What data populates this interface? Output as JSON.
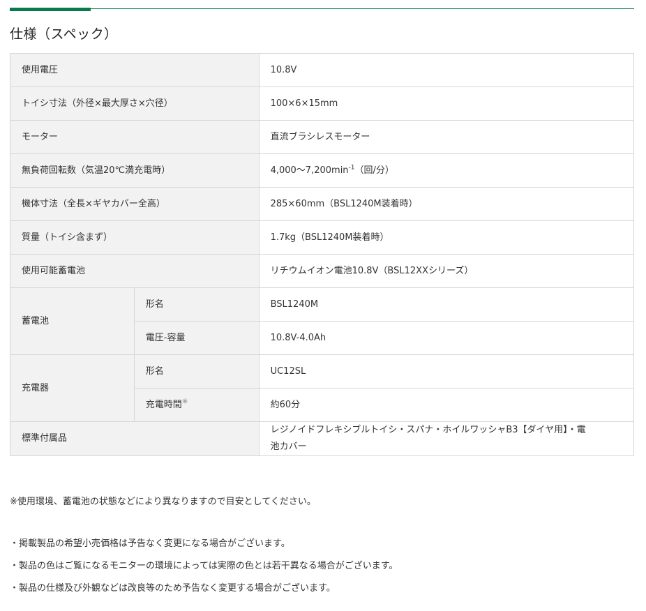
{
  "section_title": "仕様（スペック）",
  "rows": {
    "voltage": {
      "label": "使用電圧",
      "value": "10.8V"
    },
    "wheel": {
      "label": "トイシ寸法（外径×最大厚さ×穴径）",
      "value": "100×6×15mm"
    },
    "motor": {
      "label": "モーター",
      "value": "直流ブラシレスモーター"
    },
    "no_load": {
      "label": "無負荷回転数（気温20℃満充電時）",
      "value_main": "4,000〜7,200min",
      "value_sup": "-1",
      "value_unit": "（回/分）"
    },
    "dimensions": {
      "label": "機体寸法（全長×ギヤカバー全高）",
      "value": "285×60mm（BSL1240M装着時）"
    },
    "weight": {
      "label": "質量（トイシ含まず）",
      "value": "1.7kg（BSL1240M装着時）"
    },
    "battery_compat": {
      "label": "使用可能蓄電池",
      "value": "リチウムイオン電池10.8V（BSL12XXシリーズ）"
    },
    "battery": {
      "label": "蓄電池",
      "model_label": "形名",
      "model_value": "BSL1240M",
      "capacity_label": "電圧-容量",
      "capacity_value": "10.8V-4.0Ah"
    },
    "charger": {
      "label": "充電器",
      "model_label": "形名",
      "model_value": "UC12SL",
      "time_label": "充電時間",
      "time_mark": "※",
      "time_value": "約60分"
    },
    "accessories": {
      "label": "標準付属品",
      "value_line1": "レジノイドフレキシブルトイシ・スパナ・ホイルワッシャB3【ダイヤ用】・電",
      "value_line2": "池カバー"
    }
  },
  "note": "※使用環境、蓄電池の状態などにより異なりますので目安としてください。",
  "disclaimers": [
    "・掲載製品の希望小売価格は予告なく変更になる場合がございます。",
    "・製品の色はご覧になるモニターの環境によっては実際の色とは若干異なる場合がございます。",
    "・製品の仕様及び外観などは改良等のため予告なく変更する場合がございます。"
  ],
  "colors": {
    "accent": "#0b7a4b",
    "label_bg": "#f2f2f2",
    "border": "#d6d6d6"
  }
}
